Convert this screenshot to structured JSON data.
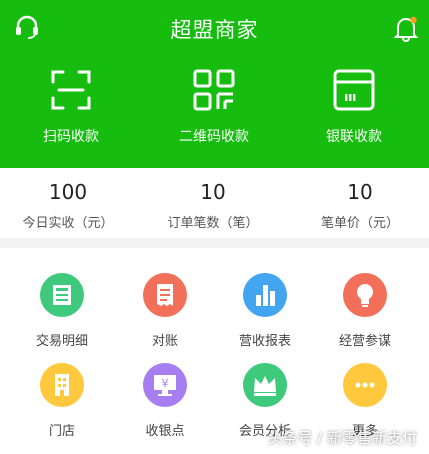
{
  "header": {
    "title": "超盟商家"
  },
  "actions": [
    {
      "label": "扫码收款",
      "icon": "scan-icon"
    },
    {
      "label": "二维码收款",
      "icon": "qr-code-icon"
    },
    {
      "label": "银联收款",
      "icon": "card-terminal-icon"
    }
  ],
  "stats": [
    {
      "value": "100",
      "label": "今日实收（元）"
    },
    {
      "value": "10",
      "label": "订单笔数（笔）"
    },
    {
      "value": "10",
      "label": "笔单价（元）"
    }
  ],
  "tiles": [
    {
      "label": "交易明细",
      "icon": "transaction-list-icon",
      "color": "#3ec97d"
    },
    {
      "label": "对账",
      "icon": "receipt-icon",
      "color": "#f26f59"
    },
    {
      "label": "营收报表",
      "icon": "bar-chart-icon",
      "color": "#43a5f0"
    },
    {
      "label": "经营参谋",
      "icon": "lightbulb-icon",
      "color": "#f26f59"
    },
    {
      "label": "门店",
      "icon": "store-building-icon",
      "color": "#ffc83d"
    },
    {
      "label": "收银点",
      "icon": "cashier-monitor-icon",
      "color": "#a77ef0"
    },
    {
      "label": "会员分析",
      "icon": "crown-icon",
      "color": "#3ec97d"
    },
    {
      "label": "更多",
      "icon": "more-dots-icon",
      "color": "#ffc83d"
    }
  ],
  "watermark": "头条号 / 新零售新支付",
  "colors": {
    "brand_green": "#16bd0f",
    "background": "#f4f4f4"
  }
}
